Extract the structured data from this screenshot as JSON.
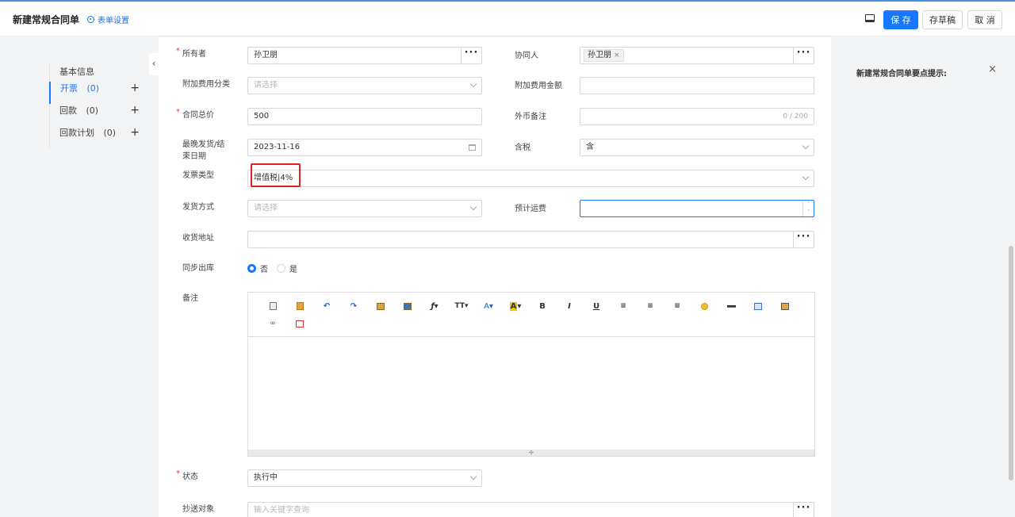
{
  "header": {
    "title": "新建常规合同单",
    "form_settings": "表单设置",
    "save": "保 存",
    "draft": "存草稿",
    "cancel": "取 消"
  },
  "nav": {
    "items": [
      {
        "label": "基本信息",
        "count": ""
      },
      {
        "label": "开票",
        "count": "(0)"
      },
      {
        "label": "回款",
        "count": "(0)"
      },
      {
        "label": "回款计划",
        "count": "(0)"
      }
    ]
  },
  "form": {
    "owner_label": "所有者",
    "owner_value": "孙卫朋",
    "collab_label": "协同人",
    "collab_tag": "孙卫朋",
    "fee_category_label": "附加费用分类",
    "fee_category_placeholder": "请选择",
    "fee_amount_label": "附加费用金额",
    "total_label": "合同总价",
    "total_value": "500",
    "fx_note_label": "外币备注",
    "fx_note_counter": "0 / 200",
    "latest_date_label": "最晚发货/结束日期",
    "latest_date_value": "2023-11-16",
    "tax_label": "含税",
    "tax_value": "含",
    "invoice_type_label": "发票类型",
    "invoice_type_value": "增值税|4%",
    "ship_method_label": "发货方式",
    "ship_method_placeholder": "请选择",
    "est_freight_label": "预计运费",
    "address_label": "收货地址",
    "sync_label": "同步出库",
    "sync_no": "否",
    "sync_yes": "是",
    "remark_label": "备注",
    "status_label": "状态",
    "status_value": "执行中",
    "cc_label": "抄送对象",
    "cc_placeholder": "输入关键字查询"
  },
  "right_panel": {
    "tip_title": "新建常规合同单要点提示:"
  }
}
